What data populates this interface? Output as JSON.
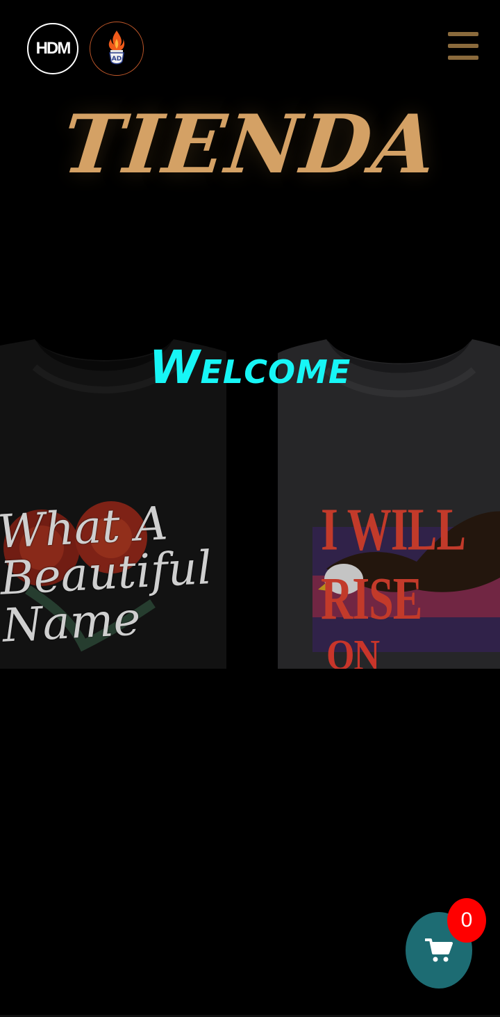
{
  "header": {
    "logo_hdm_text": "HDM",
    "logo_ad_text": "AD",
    "menu_icon": "hamburger-menu-icon"
  },
  "page": {
    "title": "TIENDA",
    "welcome": "Welcome"
  },
  "hero": {
    "left_shirt_text": "What A Beautiful Name",
    "right_shirt_text_top": "I WILL RISE",
    "right_shirt_text_bottom": "ON EAGLE'S"
  },
  "cart": {
    "icon": "shopping-cart-icon",
    "count": "0",
    "accent_color": "#1d6c73",
    "badge_color": "#ff0000"
  },
  "colors": {
    "title": "#d4a165",
    "welcome": "#17f6f6",
    "menu": "#8a6a3c"
  }
}
